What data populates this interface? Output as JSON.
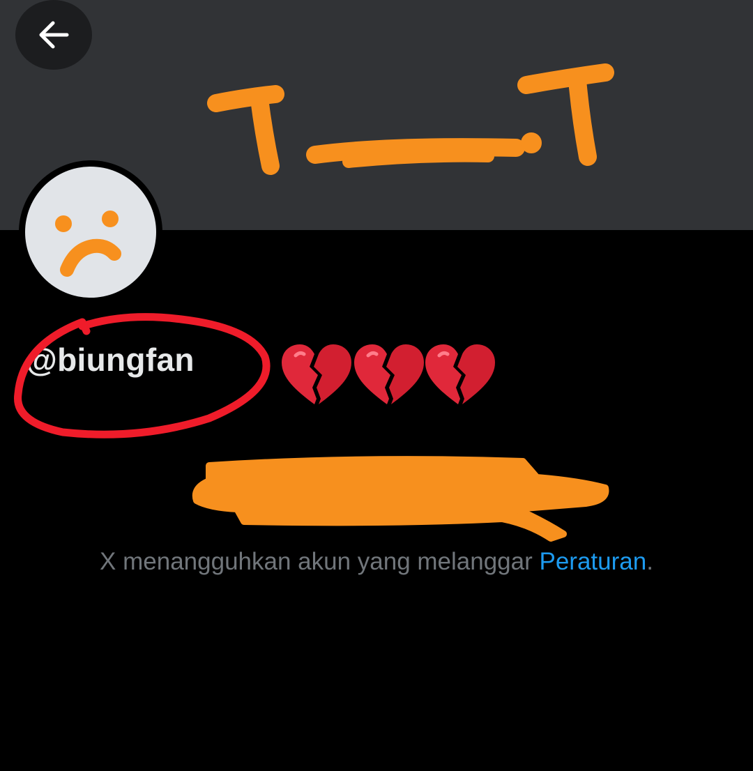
{
  "profile": {
    "handle": "@biungfan",
    "emoji": "💔💔💔"
  },
  "suspension": {
    "message": "X menangguhkan akun yang melanggar ",
    "rules_link": "Peraturan",
    "period": "."
  },
  "icons": {
    "back": "arrow-left-icon",
    "heart": "broken-heart-icon"
  },
  "colors": {
    "banner": "#313336",
    "background": "#000000",
    "scribble_orange": "#f7901e",
    "scribble_red": "#ef1c2a",
    "link_blue": "#1d9bf0",
    "muted_text": "#71767b",
    "broken_heart": "#e0283a"
  }
}
